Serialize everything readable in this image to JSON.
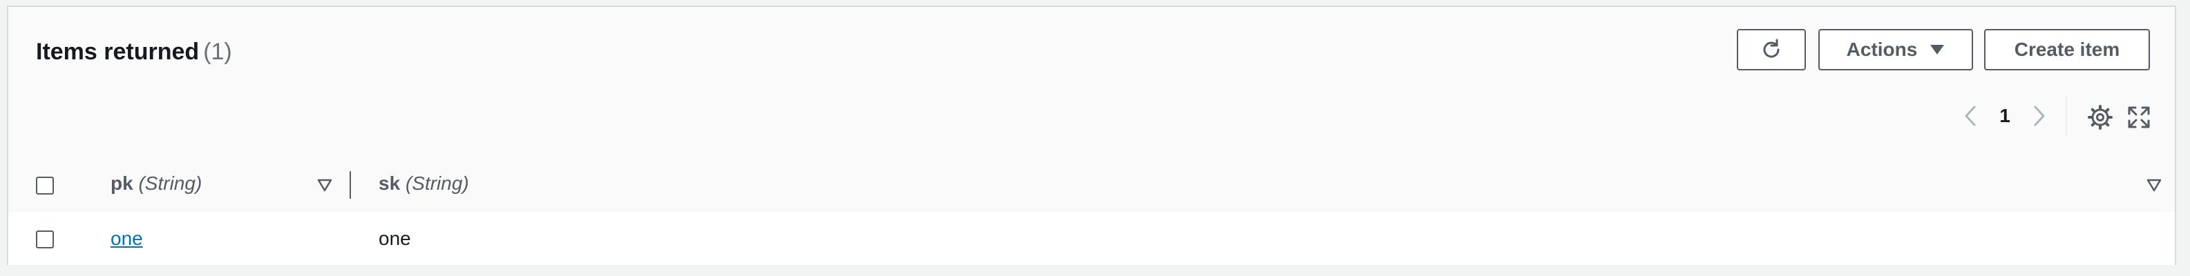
{
  "header": {
    "title": "Items returned",
    "count": "(1)"
  },
  "toolbar": {
    "refresh_icon": "refresh-icon",
    "actions_label": "Actions",
    "create_label": "Create item"
  },
  "pagination": {
    "current_page": "1"
  },
  "tools": {
    "settings_icon": "gear-icon",
    "fullscreen_icon": "expand-icon"
  },
  "table": {
    "columns": [
      {
        "name": "pk",
        "type": "(String)"
      },
      {
        "name": "sk",
        "type": "(String)"
      }
    ],
    "rows": [
      {
        "pk": "one",
        "sk": "one"
      }
    ]
  },
  "colors": {
    "link": "#0073bb",
    "button_border": "#545b64",
    "header_bg": "#fafafa"
  }
}
